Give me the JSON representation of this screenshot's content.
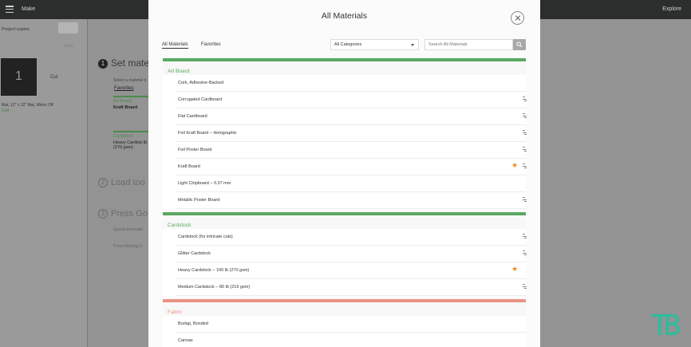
{
  "topbar": {
    "menu_icon": "hamburger-icon",
    "make_label": "Make",
    "explore_label": "Explore"
  },
  "left_panel": {
    "copies_label": "Project copies:",
    "done_label": "Done",
    "mat_number": "1",
    "cut_label": "Cut",
    "mat_info": "Mat, 12\" x 12\" Mat, Mirror Off",
    "edit_label": "Edit"
  },
  "background": {
    "step1": {
      "number": "1",
      "text": "Set mater"
    },
    "step1_hint": "Select a material b",
    "favorites_label": "Favorites",
    "card1": {
      "category": "Art Board",
      "name": "Kraft Board"
    },
    "card2": {
      "category": "Cardstock",
      "name": "Heavy Cardsto lb (270 gsm)"
    },
    "step2": {
      "number": "2",
      "text": "Load too"
    },
    "step3": {
      "number": "3",
      "text": "Press Go"
    },
    "step3_hint1": "Speed automatic",
    "step3_hint2": "Press flashing G"
  },
  "modal": {
    "title": "All Materials",
    "close_icon": "close-icon",
    "tabs": [
      {
        "label": "All Materials",
        "active": true
      },
      {
        "label": "Favorites",
        "active": false
      }
    ],
    "category_select": {
      "value": "All Categories"
    },
    "search": {
      "placeholder": "Search All Materials",
      "icon": "search-icon"
    },
    "sections": [
      {
        "title": "Art Board",
        "color": "#5aa863",
        "items": [
          {
            "name": "Cork, Adhesive-Backed",
            "favorite": false,
            "cut_icon": false
          },
          {
            "name": "Corrugated Cardboard",
            "favorite": false,
            "cut_icon": true
          },
          {
            "name": "Flat Cardboard",
            "favorite": false,
            "cut_icon": true
          },
          {
            "name": "Foil Kraft Board  – Holographic",
            "favorite": false,
            "cut_icon": true
          },
          {
            "name": "Foil Poster Board",
            "favorite": false,
            "cut_icon": true
          },
          {
            "name": "Kraft Board",
            "favorite": true,
            "cut_icon": true
          },
          {
            "name": "Light Chipboard – 0.37 mm",
            "favorite": false,
            "cut_icon": false
          },
          {
            "name": "Metallic Poster Board",
            "favorite": false,
            "cut_icon": true
          }
        ]
      },
      {
        "title": "Cardstock",
        "color": "#5aa863",
        "items": [
          {
            "name": "Cardstock (for intricate cuts)",
            "favorite": false,
            "cut_icon": true
          },
          {
            "name": "Glitter Cardstock",
            "favorite": false,
            "cut_icon": true
          },
          {
            "name": "Heavy Cardstock – 100 lb (270 gsm)",
            "favorite": true,
            "cut_icon": false
          },
          {
            "name": "Medium Cardstock – 80 lb (216 gsm)",
            "favorite": false,
            "cut_icon": true
          }
        ]
      },
      {
        "title": "Fabric",
        "color": "#e99485",
        "items": [
          {
            "name": "Burlap, Bonded",
            "favorite": false,
            "cut_icon": false
          },
          {
            "name": "Canvas",
            "favorite": false,
            "cut_icon": false
          }
        ]
      }
    ]
  },
  "watermark": "TB"
}
